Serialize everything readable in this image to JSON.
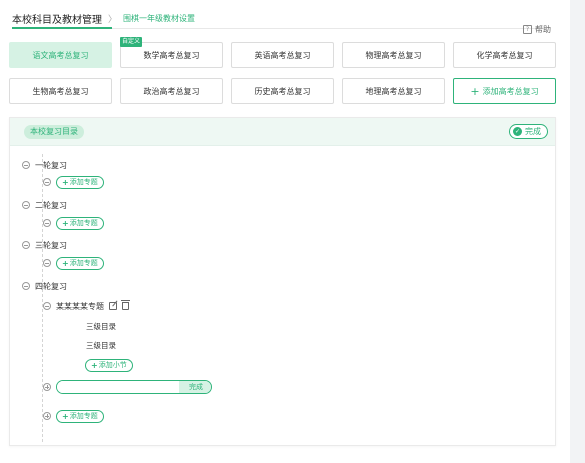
{
  "breadcrumb": {
    "root": "本校科目及教材管理",
    "separator": "〉",
    "current": "围棋一年级教材设置"
  },
  "help": {
    "label": "帮助"
  },
  "subjects": [
    {
      "label": "语文高考总复习",
      "active": true
    },
    {
      "label": "数学高考总复习",
      "tag": "自定义"
    },
    {
      "label": "英语高考总复习"
    },
    {
      "label": "物理高考总复习"
    },
    {
      "label": "化学高考总复习"
    },
    {
      "label": "生物高考总复习"
    },
    {
      "label": "政治高考总复习"
    },
    {
      "label": "历史高考总复习"
    },
    {
      "label": "地理高考总复习"
    }
  ],
  "add_subject": {
    "icon": "+",
    "label": "添加高考总复习"
  },
  "panel": {
    "title": "本校复习目录",
    "done_label": "完成"
  },
  "tree": {
    "rounds": [
      {
        "label": "一轮复习",
        "add_label": "添加专题"
      },
      {
        "label": "二轮复习",
        "add_label": "添加专题"
      },
      {
        "label": "三轮复习",
        "add_label": "添加专题"
      },
      {
        "label": "四轮复习",
        "topic": "某某某某专题",
        "level3": [
          "三级目录",
          "三级目录"
        ],
        "add_section_label": "添加小节",
        "new_topic_placeholder": "",
        "new_topic_done": "完成",
        "add_label": "添加专题"
      }
    ],
    "plus_sign": "+"
  },
  "colors": {
    "accent": "#2eb37a",
    "active_bg": "#d6f2e4",
    "panel_head": "#eef8f3"
  }
}
